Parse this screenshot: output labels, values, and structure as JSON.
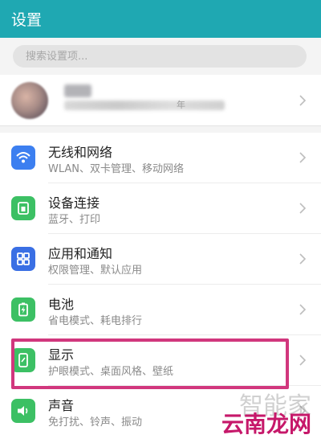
{
  "header": {
    "title": "设置"
  },
  "search": {
    "placeholder": "搜索设置项..."
  },
  "account": {
    "partial_text": "年"
  },
  "items": [
    {
      "name": "无线和网络",
      "desc": "WLAN、双卡管理、移动网络",
      "icon": "wifi-icon",
      "color": "#3c7ff0"
    },
    {
      "name": "设备连接",
      "desc": "蓝牙、打印",
      "icon": "device-connection-icon",
      "color": "#3cc064"
    },
    {
      "name": "应用和通知",
      "desc": "权限管理、默认应用",
      "icon": "apps-grid-icon",
      "color": "#3a6fe4"
    },
    {
      "name": "电池",
      "desc": "省电模式、耗电排行",
      "icon": "battery-icon",
      "color": "#3cc064"
    },
    {
      "name": "显示",
      "desc": "护眼模式、桌面风格、壁纸",
      "icon": "display-icon",
      "color": "#3cc064"
    },
    {
      "name": "声音",
      "desc": "免打扰、铃声、振动",
      "icon": "speaker-icon",
      "color": "#3cc064"
    }
  ],
  "highlight_color": "#d1377d",
  "watermark": {
    "line1": "智能家",
    "line2": "云南龙网"
  }
}
